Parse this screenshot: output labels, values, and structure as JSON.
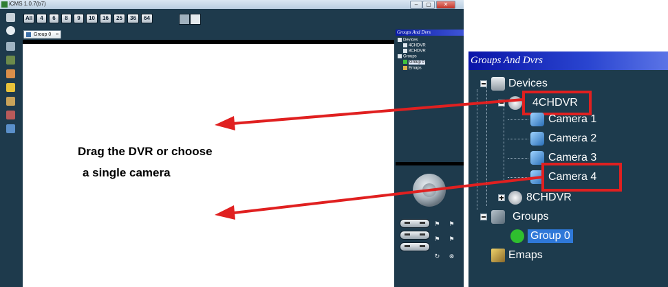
{
  "window": {
    "title": "iCMS 1.0.7(b7)",
    "buttons": [
      "–",
      "▢",
      "✕"
    ]
  },
  "toolbar": {
    "split_buttons": [
      "All",
      "4",
      "6",
      "8",
      "9",
      "10",
      "16",
      "25",
      "36",
      "64"
    ]
  },
  "tabs": [
    {
      "label": "Group 0"
    }
  ],
  "small_panel": {
    "title": "Groups And Dvrs",
    "devices": "Devices",
    "dvrs": [
      "4CHDVR",
      "8CHDVR"
    ],
    "groups": "Groups",
    "group_items": [
      "Group 0"
    ],
    "emaps": "Emaps"
  },
  "instruction": {
    "line1": "Drag the DVR or choose",
    "line2": "a single camera"
  },
  "zoom_panel": {
    "title": "Groups And Dvrs",
    "devices": "Devices",
    "dvr1": "4CHDVR",
    "cameras": [
      "Camera 1",
      "Camera 2",
      "Camera 3",
      "Camera 4"
    ],
    "dvr2": "8CHDVR",
    "groups": "Groups",
    "group0": "Group 0",
    "emaps": "Emaps"
  },
  "colors": {
    "app_bg": "#1e3a4c",
    "title_bar": "#1a2fb8",
    "highlight": "#e02020",
    "selection": "#2f78d8"
  },
  "icons": [
    "app-icon",
    "drag-tool-icon",
    "gear-icon",
    "view-icon",
    "record-icon",
    "image-icon",
    "key-icon",
    "edit-icon",
    "lock-icon",
    "export-icon",
    "snapshot-icon",
    "camera-icon",
    "ptz-joystick-icon",
    "flag-icon",
    "refresh-icon",
    "cancel-icon",
    "folder-icon",
    "server-icon",
    "dvr-icon",
    "group-icon",
    "check-icon",
    "map-icon"
  ]
}
